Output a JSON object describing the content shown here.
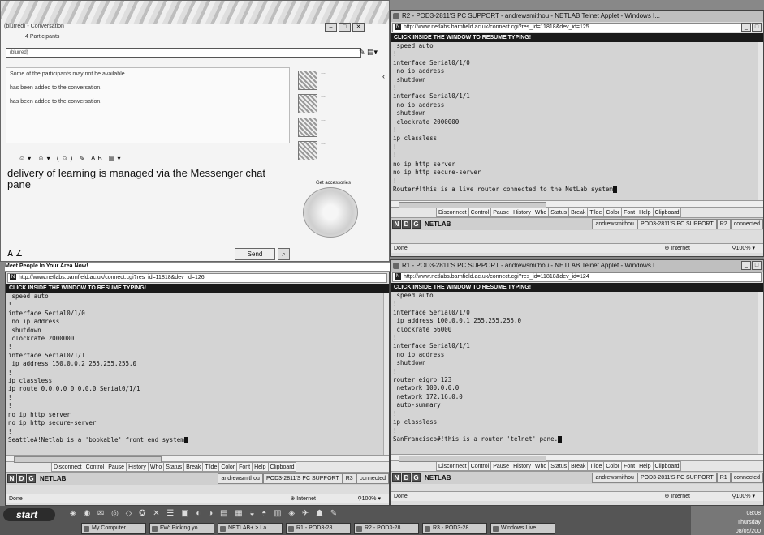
{
  "chat": {
    "title": "(blurred) - Conversation",
    "participants": "4 Participants",
    "toolbar_text": "(blurred)",
    "notice": "Some of the participants may not be available.",
    "messages": [
      "has been added to the conversation.",
      "has been added to the conversation."
    ],
    "compose_text": "delivery of learning is managed via the Messenger chat pane",
    "send_label": "Send",
    "accessories_label": "Get accessories",
    "font_label": "A"
  },
  "meet_banner": "Meet People In Your Area Now!",
  "windows": [
    {
      "id": "r2",
      "title": "R2 - POD3-2811'S PC SUPPORT - andrewsmithou - NETLAB Telnet Applet - Windows I...",
      "url": "http://www.netlabs.barnfield.ac.uk/connect.cgi?res_id=11818&dev_id=125",
      "banner": "CLICK INSIDE THE WINDOW TO RESUME TYPING!",
      "lines": [
        " speed auto",
        "!",
        "interface Serial0/1/0",
        " no ip address",
        " shutdown",
        "!",
        "interface Serial0/1/1",
        " no ip address",
        " shutdown",
        " clockrate 2000000",
        "!",
        "ip classless",
        "!",
        "!",
        "no ip http server",
        "no ip http secure-server",
        "!"
      ],
      "prompt": "Router#!this is a live router connected to the NetLab system",
      "user": "andrewsmithou",
      "pod": "POD3-2811'S PC SUPPORT",
      "device": "R2",
      "state": "connected",
      "status_left": "Done",
      "zone": "Internet",
      "zoom": "100%"
    },
    {
      "id": "r3",
      "title": "http://www.netlabs.barnfield.ac.uk/connect.cgi?res_id=11818&dev_id=126",
      "url": "http://www.netlabs.barnfield.ac.uk/connect.cgi?res_id=11818&dev_id=126",
      "banner": "CLICK INSIDE THE WINDOW TO RESUME TYPING!",
      "lines": [
        " speed auto",
        "!",
        "interface Serial0/1/0",
        " no ip address",
        " shutdown",
        " clockrate 2000000",
        "!",
        "interface Serial0/1/1",
        " ip address 150.0.0.2 255.255.255.0",
        "!",
        "ip classless",
        "ip route 0.0.0.0 0.0.0.0 Serial0/1/1",
        "!",
        "!",
        "no ip http server",
        "no ip http secure-server",
        "!"
      ],
      "prompt": "Seattle#!Netlab is a 'bookable' front end system",
      "user": "andrewsmithou",
      "pod": "POD3-2811'S PC SUPPORT",
      "device": "R3",
      "state": "connected",
      "status_left": "Done",
      "zone": "Internet",
      "zoom": "100%"
    },
    {
      "id": "r1",
      "title": "R1 - POD3-2811'S PC SUPPORT - andrewsmithou - NETLAB Telnet Applet - Windows I...",
      "url": "http://www.netlabs.barnfield.ac.uk/connect.cgi?res_id=11818&dev_id=124",
      "banner": "CLICK INSIDE THE WINDOW TO RESUME TYPING!",
      "lines": [
        " speed auto",
        "!",
        "interface Serial0/1/0",
        " ip address 100.0.0.1 255.255.255.0",
        " clockrate 56000",
        "!",
        "interface Serial0/1/1",
        " no ip address",
        " shutdown",
        "!",
        "router eigrp 123",
        " network 100.0.0.0",
        " network 172.16.0.0",
        " auto-summary",
        "!",
        "ip classless",
        "!"
      ],
      "prompt": "SanFrancisco#!this is a router 'telnet' pane.",
      "user": "andrewsmithou",
      "pod": "POD3-2811'S PC SUPPORT",
      "device": "R1",
      "state": "connected",
      "status_left": "Done",
      "zone": "Internet",
      "zoom": "100%"
    }
  ],
  "applet_buttons": [
    "Disconnect",
    "Control",
    "Pause",
    "History",
    "Who",
    "Status",
    "Break",
    "Tilde",
    "Color",
    "Font",
    "Help",
    "Clipboard"
  ],
  "brand": "NETLAB",
  "taskbar": {
    "start": "start",
    "tasks": [
      "My Computer",
      "FW: Picking yo...",
      "NETLAB+ > La...",
      "R1 - POD3-28...",
      "R2 - POD3-28...",
      "R3 - POD3-28...",
      "Windows Live ..."
    ],
    "time": "08:08",
    "day": "Thursday",
    "date": "08/05/200"
  }
}
